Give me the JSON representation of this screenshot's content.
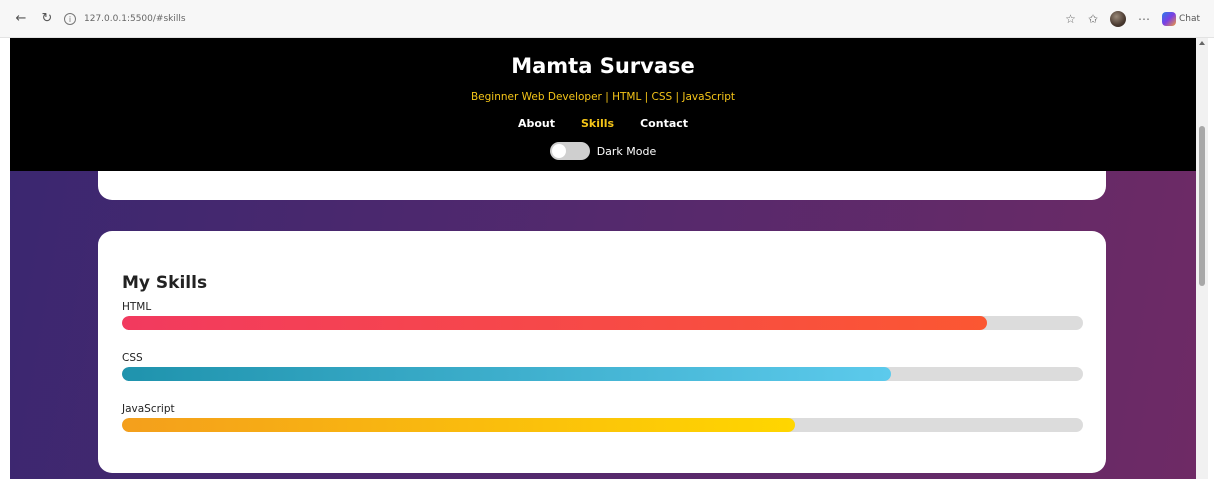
{
  "browser": {
    "url": "127.0.0.1:5500/#skills",
    "copilot_label": "Chat",
    "icons": [
      "back-arrow-icon",
      "refresh-icon",
      "info-icon",
      "star-icon",
      "favorites-icon",
      "profile-avatar",
      "more-icon",
      "copilot-icon"
    ]
  },
  "header": {
    "title": "Mamta Survase",
    "subtitle": "Beginner Web Developer | HTML | CSS | JavaScript",
    "nav": [
      {
        "label": "About",
        "active": false
      },
      {
        "label": "Skills",
        "active": true
      },
      {
        "label": "Contact",
        "active": false
      }
    ],
    "dark_mode_label": "Dark Mode",
    "dark_mode_on": false
  },
  "skills": {
    "heading": "My Skills",
    "items": [
      {
        "label": "HTML",
        "percent": 90
      },
      {
        "label": "CSS",
        "percent": 80
      },
      {
        "label": "JavaScript",
        "percent": 70
      }
    ]
  },
  "colors": {
    "header_bg": "#000000",
    "accent": "#f5c518",
    "html_bar": "#f7455a",
    "css_bar": "#3db3d4",
    "js_bar": "#fbbf10",
    "track": "#dcdcdc"
  }
}
